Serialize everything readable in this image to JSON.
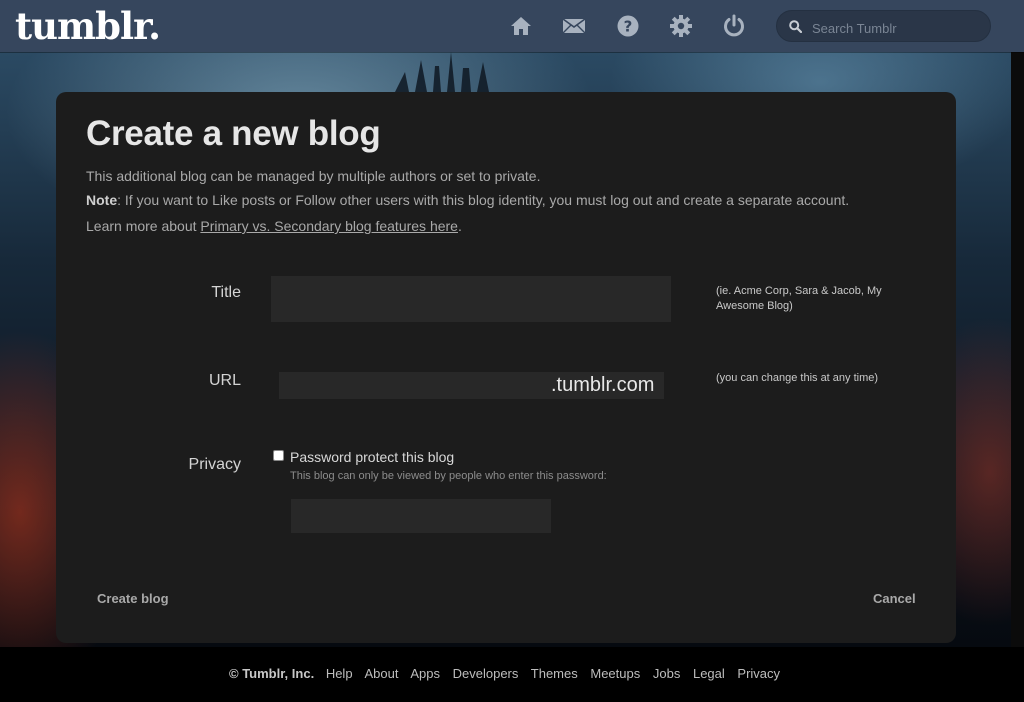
{
  "header": {
    "logo": "tumblr.",
    "icons": [
      "home-icon",
      "mail-icon",
      "help-icon",
      "gear-icon",
      "power-icon"
    ],
    "search_placeholder": "Search Tumblr"
  },
  "dialog": {
    "title": "Create a new blog",
    "line1": "This additional blog can be managed by multiple authors or set to private.",
    "note_label": "Note",
    "note_text": ": If you want to Like posts or Follow other users with this blog identity, you must log out and create a separate account.",
    "learn_prefix": "Learn more about ",
    "learn_link": "Primary vs. Secondary blog features here",
    "learn_suffix": ".",
    "title_label": "Title",
    "title_value": "",
    "title_hint": "(ie. Acme Corp, Sara & Jacob, My Awesome Blog)",
    "url_label": "URL",
    "url_value": "",
    "url_suffix": ".tumblr.com",
    "url_hint": "(you can change this at any time)",
    "privacy_label": "Privacy",
    "password_checkbox_label": "Password protect this blog",
    "password_checked": false,
    "password_hint": "This blog can only be viewed by people who enter this password:",
    "password_value": "",
    "create_button": "Create blog",
    "cancel_button": "Cancel"
  },
  "footer": {
    "copyright": "© Tumblr, Inc.",
    "links": [
      "Help",
      "About",
      "Apps",
      "Developers",
      "Themes",
      "Meetups",
      "Jobs",
      "Legal",
      "Privacy"
    ]
  }
}
